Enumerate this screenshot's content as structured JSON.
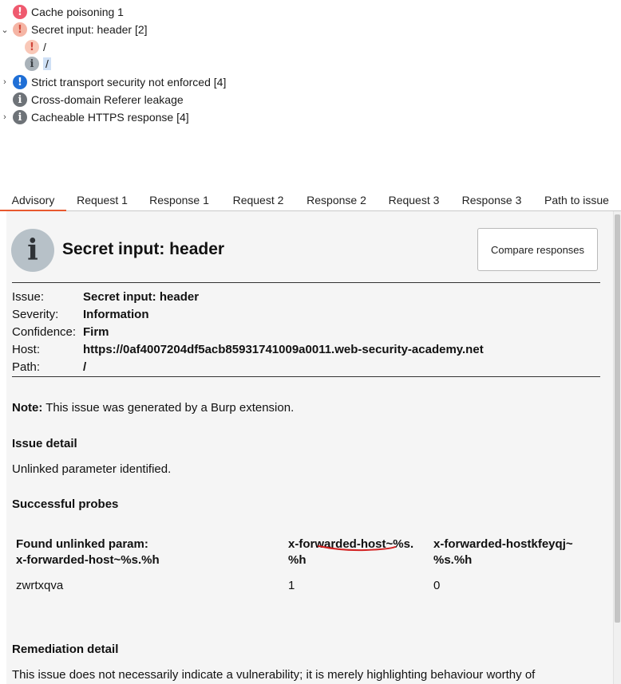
{
  "tree": {
    "items": [
      {
        "label": "Cache poisoning 1",
        "icon": "exclamation-icon",
        "severity": "high"
      },
      {
        "label": "Secret input: header [2]",
        "icon": "exclamation-icon",
        "severity": "medium",
        "expanded": true
      },
      {
        "label": "/",
        "icon": "exclamation-icon",
        "severity": "low"
      },
      {
        "label": "/",
        "icon": "info-icon",
        "severity": "information",
        "selected": true
      },
      {
        "label": "Strict transport security not enforced [4]",
        "icon": "exclamation-icon",
        "severity": "blue"
      },
      {
        "label": "Cross-domain Referer leakage",
        "icon": "info-icon",
        "severity": "information"
      },
      {
        "label": "Cacheable HTTPS response [4]",
        "icon": "info-icon",
        "severity": "information"
      }
    ]
  },
  "tabs": [
    "Advisory",
    "Request 1",
    "Response 1",
    "Request 2",
    "Response 2",
    "Request 3",
    "Response 3",
    "Path to issue"
  ],
  "advisory": {
    "title": "Secret input: header",
    "compare_button": "Compare responses",
    "details": [
      {
        "key": "Issue:",
        "value": "Secret input: header"
      },
      {
        "key": "Severity:",
        "value": "Information"
      },
      {
        "key": "Confidence:",
        "value": "Firm"
      },
      {
        "key": "Host:",
        "value": "https://0af4007204df5acb85931741009a0011.web-security-academy.net"
      },
      {
        "key": "Path:",
        "value": "/"
      }
    ],
    "note_label": "Note:",
    "note_text": " This issue was generated by a Burp extension.",
    "issue_detail_heading": "Issue detail",
    "issue_detail_text": "Unlinked parameter identified.",
    "probes_heading": "Successful probes",
    "probes_table": {
      "headers": [
        [
          "Found unlinked param:",
          "x-forwarded-host~%s.%h"
        ],
        [
          "x-forwarded-host~%s.",
          "%h"
        ],
        [
          "x-forwarded-hostkfeyqj~",
          "%s.%h"
        ]
      ],
      "row": [
        "zwrtxqva",
        "1",
        "0"
      ]
    },
    "remediation_heading": "Remediation detail",
    "remediation_text": "This issue does not necessarily indicate a vulnerability; it is merely highlighting behaviour worthy of"
  },
  "colors": {
    "tab_active_underline": "#e8582e",
    "annotation_underline": "#d21f1f",
    "selected_row": "#cfe0f5"
  }
}
